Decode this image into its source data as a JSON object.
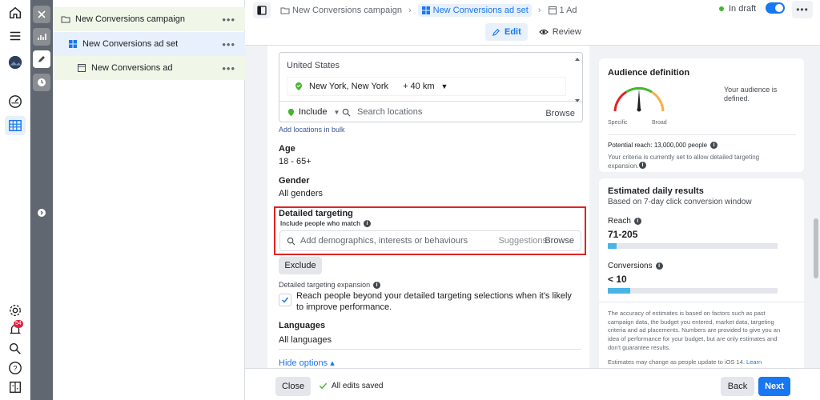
{
  "tree": {
    "campaign": "New Conversions campaign",
    "adset": "New Conversions ad set",
    "ad": "New Conversions ad",
    "more": "•••"
  },
  "breadcrumb": {
    "campaign": "New Conversions campaign",
    "adset": "New Conversions ad set",
    "ad": "1 Ad"
  },
  "tabs": {
    "edit": "Edit",
    "review": "Review"
  },
  "status": {
    "label": "In draft",
    "more": "•••"
  },
  "location": {
    "country": "United States",
    "city": "New York, New York",
    "radius": "+ 40 km",
    "include": "Include",
    "search_placeholder": "Search locations",
    "browse": "Browse",
    "bulk": "Add locations in bulk"
  },
  "age": {
    "heading": "Age",
    "value": "18 - 65+"
  },
  "gender": {
    "heading": "Gender",
    "value": "All genders"
  },
  "detailed": {
    "heading": "Detailed targeting",
    "sub": "Include people who match",
    "placeholder": "Add demographics, interests or behaviours",
    "suggestions": "Suggestions",
    "browse": "Browse",
    "exclude": "Exclude",
    "expansion_heading": "Detailed targeting expansion",
    "expansion_text": "Reach people beyond your detailed targeting selections when it's likely to improve performance."
  },
  "languages": {
    "heading": "Languages",
    "value": "All languages"
  },
  "hide_options": "Hide options ▴",
  "audience": {
    "title": "Audience definition",
    "status": "Your audience is defined.",
    "specific": "Specific",
    "broad": "Broad",
    "potential_reach": "Potential reach: 13,000,000 people",
    "criteria": "Your criteria is currently set to allow detailed targeting expansion."
  },
  "estimated": {
    "title": "Estimated daily results",
    "subtitle": "Based on 7-day click conversion window",
    "reach_label": "Reach",
    "reach_value": "71-205",
    "reach_fraction": 0.05,
    "conv_label": "Conversions",
    "conv_value": "< 10",
    "conv_fraction": 0.13,
    "disclaimer": "The accuracy of estimates is based on factors such as past campaign data, the budget you entered, market data, targeting criteria and ad placements. Numbers are provided to give you an idea of performance for your budget, but are only estimates and don't guarantee results.",
    "ios_note": "Estimates may change as people update to iOS 14.",
    "learn": "Learn"
  },
  "footer": {
    "close": "Close",
    "saved": "All edits saved",
    "back": "Back",
    "next": "Next"
  },
  "notifications": {
    "count": "54"
  },
  "colors": {
    "accent": "#1877f2",
    "highlight_border": "#e02424",
    "success": "#42b72a"
  }
}
